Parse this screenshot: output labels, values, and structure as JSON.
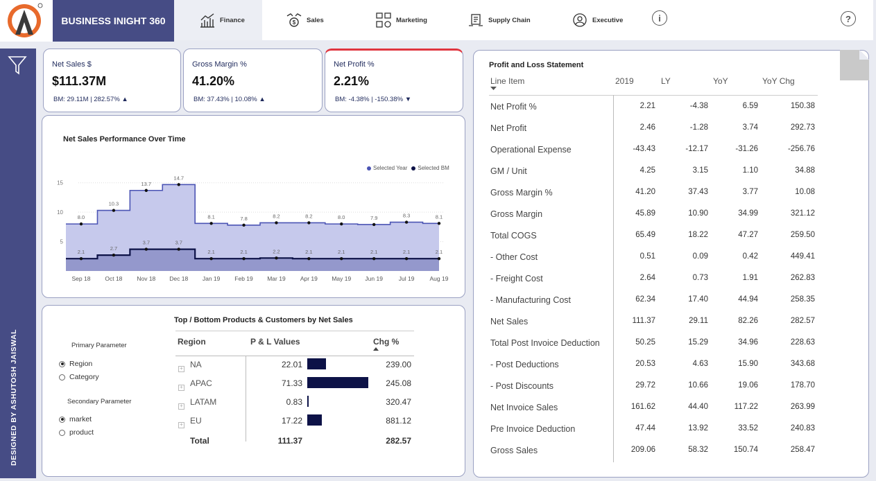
{
  "header": {
    "brand": "BUSINESS INIGHT 360",
    "tabs": [
      {
        "label": "Finance",
        "icon": "bar-chart-icon"
      },
      {
        "label": "Sales",
        "icon": "money-hand-icon"
      },
      {
        "label": "Marketing",
        "icon": "marketing-icon"
      },
      {
        "label": "Supply Chain",
        "icon": "supply-chain-icon"
      },
      {
        "label": "Executive",
        "icon": "executive-icon"
      }
    ],
    "info_glyph": "i",
    "help_glyph": "?"
  },
  "sidebar": {
    "credit": "DESIGNED BY ASHUTOSH JAISWAL"
  },
  "kpis": [
    {
      "title": "Net Sales $",
      "value": "$111.37M",
      "bm": "BM: 29.11M | 282.57%",
      "arrow": "▲"
    },
    {
      "title": "Gross Margin %",
      "value": "41.20%",
      "bm": "BM: 37.43% | 10.08%",
      "arrow": "▲"
    },
    {
      "title": "Net Profit %",
      "value": "2.21%",
      "bm": "BM: -4.38% | -150.38%",
      "arrow": "▼"
    }
  ],
  "chart_data": {
    "type": "area",
    "title": "Net Sales Performance Over Time",
    "categories": [
      "Sep 18",
      "Oct 18",
      "Nov 18",
      "Dec 18",
      "Jan 19",
      "Feb 19",
      "Mar 19",
      "Apr 19",
      "May 19",
      "Jun 19",
      "Jul 19",
      "Aug 19"
    ],
    "series": [
      {
        "name": "Selected Year",
        "values": [
          8.0,
          10.3,
          13.7,
          14.7,
          8.1,
          7.8,
          8.2,
          8.2,
          8.0,
          7.9,
          8.3,
          8.1
        ],
        "color": "#4b54b4"
      },
      {
        "name": "Selected BM",
        "values": [
          2.1,
          2.7,
          3.7,
          3.7,
          2.1,
          2.1,
          2.2,
          2.1,
          2.1,
          2.1,
          2.1,
          2.1
        ],
        "color": "#0d1247"
      }
    ],
    "y_ticks": [
      5,
      10,
      15
    ],
    "ylim": [
      0,
      16.5
    ],
    "legend_position": "top-right",
    "grid": true
  },
  "params": {
    "primary_title": "Primary Parameter",
    "primary_options": [
      {
        "label": "Region",
        "selected": true
      },
      {
        "label": "Category",
        "selected": false
      }
    ],
    "secondary_title": "Secondary Parameter",
    "secondary_options": [
      {
        "label": "market",
        "selected": true
      },
      {
        "label": "product",
        "selected": false
      }
    ]
  },
  "products": {
    "title": "Top / Bottom Products & Customers by Net Sales",
    "columns": [
      "Region",
      "P & L Values",
      "Chg %"
    ],
    "rows": [
      {
        "region": "NA",
        "value": "22.01",
        "chg": "239.00",
        "bar": 22.01
      },
      {
        "region": "APAC",
        "value": "71.33",
        "chg": "245.08",
        "bar": 71.33
      },
      {
        "region": "LATAM",
        "value": "0.83",
        "chg": "320.47",
        "bar": 0.83
      },
      {
        "region": "EU",
        "value": "17.22",
        "chg": "881.12",
        "bar": 17.22
      }
    ],
    "total": {
      "label": "Total",
      "value": "111.37",
      "chg": "282.57"
    },
    "bar_color": "#0d1247"
  },
  "pl": {
    "title": "Profit and Loss Statement",
    "columns": [
      "Line Item",
      "2019",
      "LY",
      "YoY",
      "YoY Chg"
    ],
    "rows": [
      {
        "label": "Net Profit %",
        "v2019": "2.21",
        "ly": "-4.38",
        "yoy": "6.59",
        "chg": "150.38"
      },
      {
        "label": "Net Profit",
        "v2019": "2.46",
        "ly": "-1.28",
        "yoy": "3.74",
        "chg": "292.73"
      },
      {
        "label": "Operational Expense",
        "v2019": "-43.43",
        "ly": "-12.17",
        "yoy": "-31.26",
        "chg": "-256.76"
      },
      {
        "label": "GM / Unit",
        "v2019": "4.25",
        "ly": "3.15",
        "yoy": "1.10",
        "chg": "34.88"
      },
      {
        "label": "Gross Margin %",
        "v2019": "41.20",
        "ly": "37.43",
        "yoy": "3.77",
        "chg": "10.08"
      },
      {
        "label": "Gross Margin",
        "v2019": "45.89",
        "ly": "10.90",
        "yoy": "34.99",
        "chg": "321.12"
      },
      {
        "label": "Total COGS",
        "v2019": "65.49",
        "ly": "18.22",
        "yoy": "47.27",
        "chg": "259.50"
      },
      {
        "label": " - Other Cost",
        "v2019": "0.51",
        "ly": "0.09",
        "yoy": "0.42",
        "chg": "449.41"
      },
      {
        "label": " - Freight Cost",
        "v2019": "2.64",
        "ly": "0.73",
        "yoy": "1.91",
        "chg": "262.83"
      },
      {
        "label": " - Manufacturing Cost",
        "v2019": "62.34",
        "ly": "17.40",
        "yoy": "44.94",
        "chg": "258.35"
      },
      {
        "label": "Net Sales",
        "v2019": "111.37",
        "ly": "29.11",
        "yoy": "82.26",
        "chg": "282.57"
      },
      {
        "label": "Total Post Invoice Deduction",
        "v2019": "50.25",
        "ly": "15.29",
        "yoy": "34.96",
        "chg": "228.63"
      },
      {
        "label": " - Post Deductions",
        "v2019": "20.53",
        "ly": "4.63",
        "yoy": "15.90",
        "chg": "343.68"
      },
      {
        "label": " - Post Discounts",
        "v2019": "29.72",
        "ly": "10.66",
        "yoy": "19.06",
        "chg": "178.70"
      },
      {
        "label": "Net Invoice Sales",
        "v2019": "161.62",
        "ly": "44.40",
        "yoy": "117.22",
        "chg": "263.99"
      },
      {
        "label": "Pre Invoice Deduction",
        "v2019": "47.44",
        "ly": "13.92",
        "yoy": "33.52",
        "chg": "240.83"
      },
      {
        "label": "Gross Sales",
        "v2019": "209.06",
        "ly": "58.32",
        "yoy": "150.74",
        "chg": "258.47"
      }
    ]
  }
}
